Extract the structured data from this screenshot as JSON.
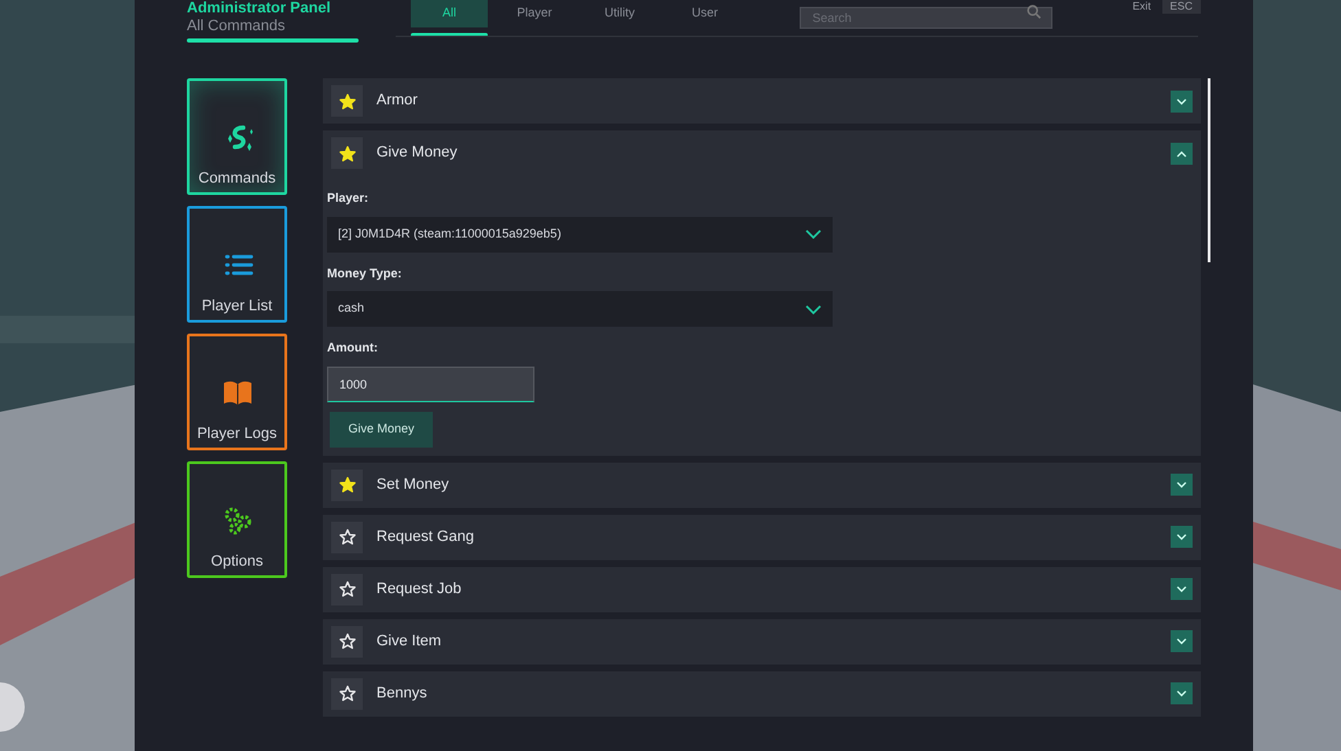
{
  "header": {
    "title": "Administrator Panel",
    "subtitle": "All Commands"
  },
  "tabs": [
    {
      "label": "All",
      "selected": true
    },
    {
      "label": "Player",
      "selected": false
    },
    {
      "label": "Utility",
      "selected": false
    },
    {
      "label": "User",
      "selected": false
    }
  ],
  "search": {
    "placeholder": "Search"
  },
  "top_buttons": [
    "Exit",
    "ESC"
  ],
  "sidebar": {
    "items": [
      {
        "label": "Commands",
        "kind": "sparkle",
        "color": "#1ed6a0",
        "selected": true
      },
      {
        "label": "Player List",
        "kind": "list",
        "color": "#1a9bdc",
        "selected": false
      },
      {
        "label": "Player Logs",
        "kind": "book",
        "color": "#e8741c",
        "selected": false
      },
      {
        "label": "Options",
        "kind": "gears",
        "color": "#4cc81e",
        "selected": false
      }
    ]
  },
  "commands": [
    {
      "name": "Armor",
      "favorite": true,
      "expanded": false
    },
    {
      "name": "Give Money",
      "favorite": true,
      "expanded": true,
      "fields": [
        {
          "kind": "select",
          "label": "Player:",
          "value": "[2] J0M1D4R (steam:11000015a929eb5)"
        },
        {
          "kind": "select",
          "label": "Money Type:",
          "value": "cash"
        },
        {
          "kind": "input",
          "label": "Amount:",
          "value": "1000"
        }
      ],
      "submit": "Give Money"
    },
    {
      "name": "Set Money",
      "favorite": true,
      "expanded": false
    },
    {
      "name": "Request Gang",
      "favorite": false,
      "expanded": false
    },
    {
      "name": "Request Job",
      "favorite": false,
      "expanded": false
    },
    {
      "name": "Give Item",
      "favorite": false,
      "expanded": false
    },
    {
      "name": "Bennys",
      "favorite": false,
      "expanded": false
    }
  ]
}
